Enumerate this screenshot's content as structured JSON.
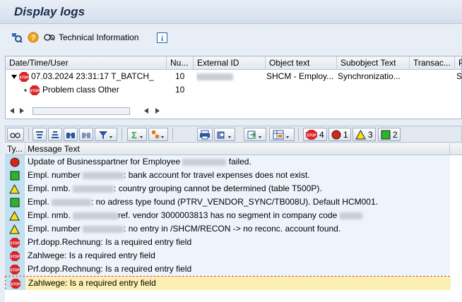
{
  "title": "Display logs",
  "toolbar": {
    "technical_info_label": "Technical Information"
  },
  "tree": {
    "columns": [
      "Date/Time/User",
      "Nu...",
      "External ID",
      "Object text",
      "Subobject Text",
      "Transac...",
      "P"
    ],
    "rows": [
      {
        "datetime_user": "07.03.2024  23:31:17  T_BATCH_",
        "number": "10",
        "object_text": "SHCM - Employ...",
        "subobject_text": "Synchronizatio...",
        "last": "S"
      },
      {
        "datetime_user": "Problem class Other",
        "number": "10"
      }
    ]
  },
  "alv": {
    "counts": {
      "stop": "4",
      "error": "1",
      "warning": "3",
      "success": "2"
    },
    "columns": [
      "Ty...",
      "Message Text"
    ],
    "messages": [
      {
        "type": "error",
        "text_a": "Update of Businesspartner for Employee ",
        "text_b": " failed."
      },
      {
        "type": "success",
        "text_a": "Empl. number ",
        "text_b": ": bank account for travel expenses does not exist."
      },
      {
        "type": "warning",
        "text_a": "Empl. nmb. ",
        "text_b": ": country grouping cannot be determined (table T500P)."
      },
      {
        "type": "success",
        "text_a": "Empl. ",
        "text_b": ": no adress type found (PTRV_VENDOR_SYNC/TB008U). Default HCM001."
      },
      {
        "type": "warning",
        "text_a": "Empl. nmb. ",
        "text_b": "ref. vendor 3000003813 has no segment in company code "
      },
      {
        "type": "warning",
        "text_a": "Empl. number ",
        "text_b": ": no entry in /SHCM/RECON -> no reconc. account found."
      },
      {
        "type": "stop",
        "text_a": "Prf.dopp.Rechnung: Is a required entry field",
        "text_b": ""
      },
      {
        "type": "stop",
        "text_a": "Zahlwege: Is a required entry field",
        "text_b": ""
      },
      {
        "type": "stop",
        "text_a": "Prf.dopp.Rechnung: Is a required entry field",
        "text_b": ""
      },
      {
        "type": "stop",
        "text_a": "Zahlwege: Is a required entry field",
        "text_b": ""
      }
    ]
  },
  "colors": {
    "stop": "#d8232a",
    "error": "#e0201a",
    "warning": "#f3e21a",
    "success": "#2bb52b",
    "selected_row": "#fbefb4"
  }
}
